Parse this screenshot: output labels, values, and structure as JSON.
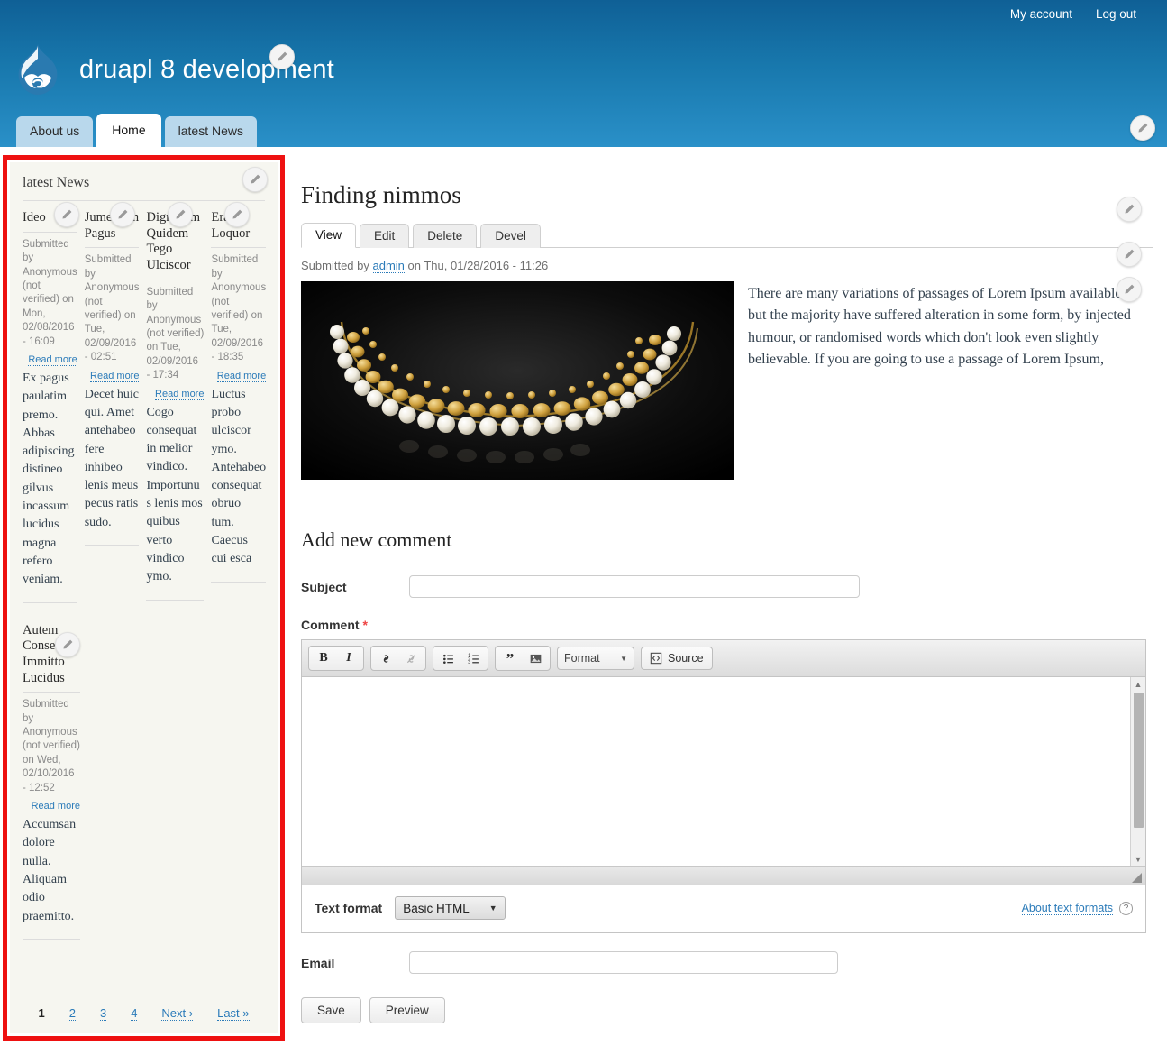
{
  "header": {
    "user_links": [
      {
        "label": "My account"
      },
      {
        "label": "Log out"
      }
    ],
    "site_name": "druapl 8 development",
    "logo_icon": "drupal-drop-logo",
    "menu": [
      {
        "label": "About us",
        "active": false
      },
      {
        "label": "Home",
        "active": true
      },
      {
        "label": "latest News",
        "active": false
      }
    ]
  },
  "sidebar": {
    "block_title": "latest News",
    "teasers": [
      {
        "title": "Ideo",
        "submitted": "Submitted by Anonymous (not verified) on Mon, 02/08/2016 - 16:09",
        "read_more": "Read more",
        "body": "Ex pagus paulatim premo. Abbas adipiscing distineo gilvus incassum lucidus magna refero veniam."
      },
      {
        "title": "Jumentum Pagus",
        "submitted": "Submitted by Anonymous (not verified) on Tue, 02/09/2016 - 02:51",
        "read_more": "Read more",
        "body": "Decet huic qui. Amet antehabeo fere inhibeo lenis meus pecus ratis sudo."
      },
      {
        "title": "Dignissim Quidem Tego Ulciscor",
        "submitted": "Submitted by Anonymous (not verified) on Tue, 02/09/2016 - 17:34",
        "read_more": "Read more",
        "body": "Cogo consequat in melior vindico. Importunus lenis mos quibus verto vindico ymo."
      },
      {
        "title": "Erat Loquor",
        "submitted": "Submitted by Anonymous (not verified) on Tue, 02/09/2016 - 18:35",
        "read_more": "Read more",
        "body": "Luctus probo ulciscor ymo. Antehabeo consequat obruo tum. Caecus cui esca"
      }
    ],
    "wide_teaser": {
      "title": "Autem Consequat Immitto Lucidus",
      "submitted": "Submitted by Anonymous (not verified) on Wed, 02/10/2016 - 12:52",
      "read_more": "Read more",
      "body": "Accumsan dolore nulla. Aliquam odio praemitto."
    },
    "pager": [
      {
        "label": "1",
        "current": true
      },
      {
        "label": "2",
        "current": false
      },
      {
        "label": "3",
        "current": false
      },
      {
        "label": "4",
        "current": false
      },
      {
        "label": "Next ›",
        "current": false
      },
      {
        "label": "Last »",
        "current": false
      }
    ]
  },
  "main": {
    "node_title": "Finding nimmos",
    "tasks": [
      {
        "label": "View",
        "active": true
      },
      {
        "label": "Edit",
        "active": false
      },
      {
        "label": "Delete",
        "active": false
      },
      {
        "label": "Devel",
        "active": false
      }
    ],
    "submitted_prefix": "Submitted by ",
    "submitted_author": "admin",
    "submitted_suffix": " on Thu, 01/28/2016 - 11:26",
    "image_alt": "gold-pearl-necklace-photo",
    "body": "There are many variations of passages of Lorem Ipsum available, but the majority have suffered alteration in some form, by injected humour, or randomised words which don't look even slightly believable. If you are going to use a passage of Lorem Ipsum,"
  },
  "comment_form": {
    "heading": "Add new comment",
    "subject_label": "Subject",
    "subject_value": "",
    "subject_placeholder": "",
    "comment_label": "Comment",
    "required_marker": "*",
    "editor_toolbar": [
      {
        "icon": "bold-icon",
        "glyph": "B"
      },
      {
        "icon": "italic-icon",
        "glyph": "I"
      },
      {
        "icon": "link-icon",
        "glyph": "⚭"
      },
      {
        "icon": "unlink-icon",
        "glyph": "⚭"
      },
      {
        "icon": "bulleted-list-icon",
        "glyph": "☰"
      },
      {
        "icon": "numbered-list-icon",
        "glyph": "≡"
      },
      {
        "icon": "blockquote-icon",
        "glyph": "”"
      },
      {
        "icon": "image-icon",
        "glyph": "Ὓc"
      }
    ],
    "format_dropdown_label": "Format",
    "source_button_label": "Source",
    "editor_value": "",
    "text_format_label": "Text format",
    "text_format_value": "Basic HTML",
    "text_format_options": [
      "Basic HTML"
    ],
    "about_text_formats_label": "About text formats",
    "help_icon": "question-mark-icon",
    "email_label": "Email",
    "email_value": "",
    "save_label": "Save",
    "preview_label": "Preview"
  },
  "colors": {
    "header_blue": "#1878ad",
    "highlight_red": "#ee1111",
    "link_blue": "#2b7bb9",
    "sidebar_bg": "#f6f6f0",
    "tab_blue": "#b9d8ec"
  }
}
